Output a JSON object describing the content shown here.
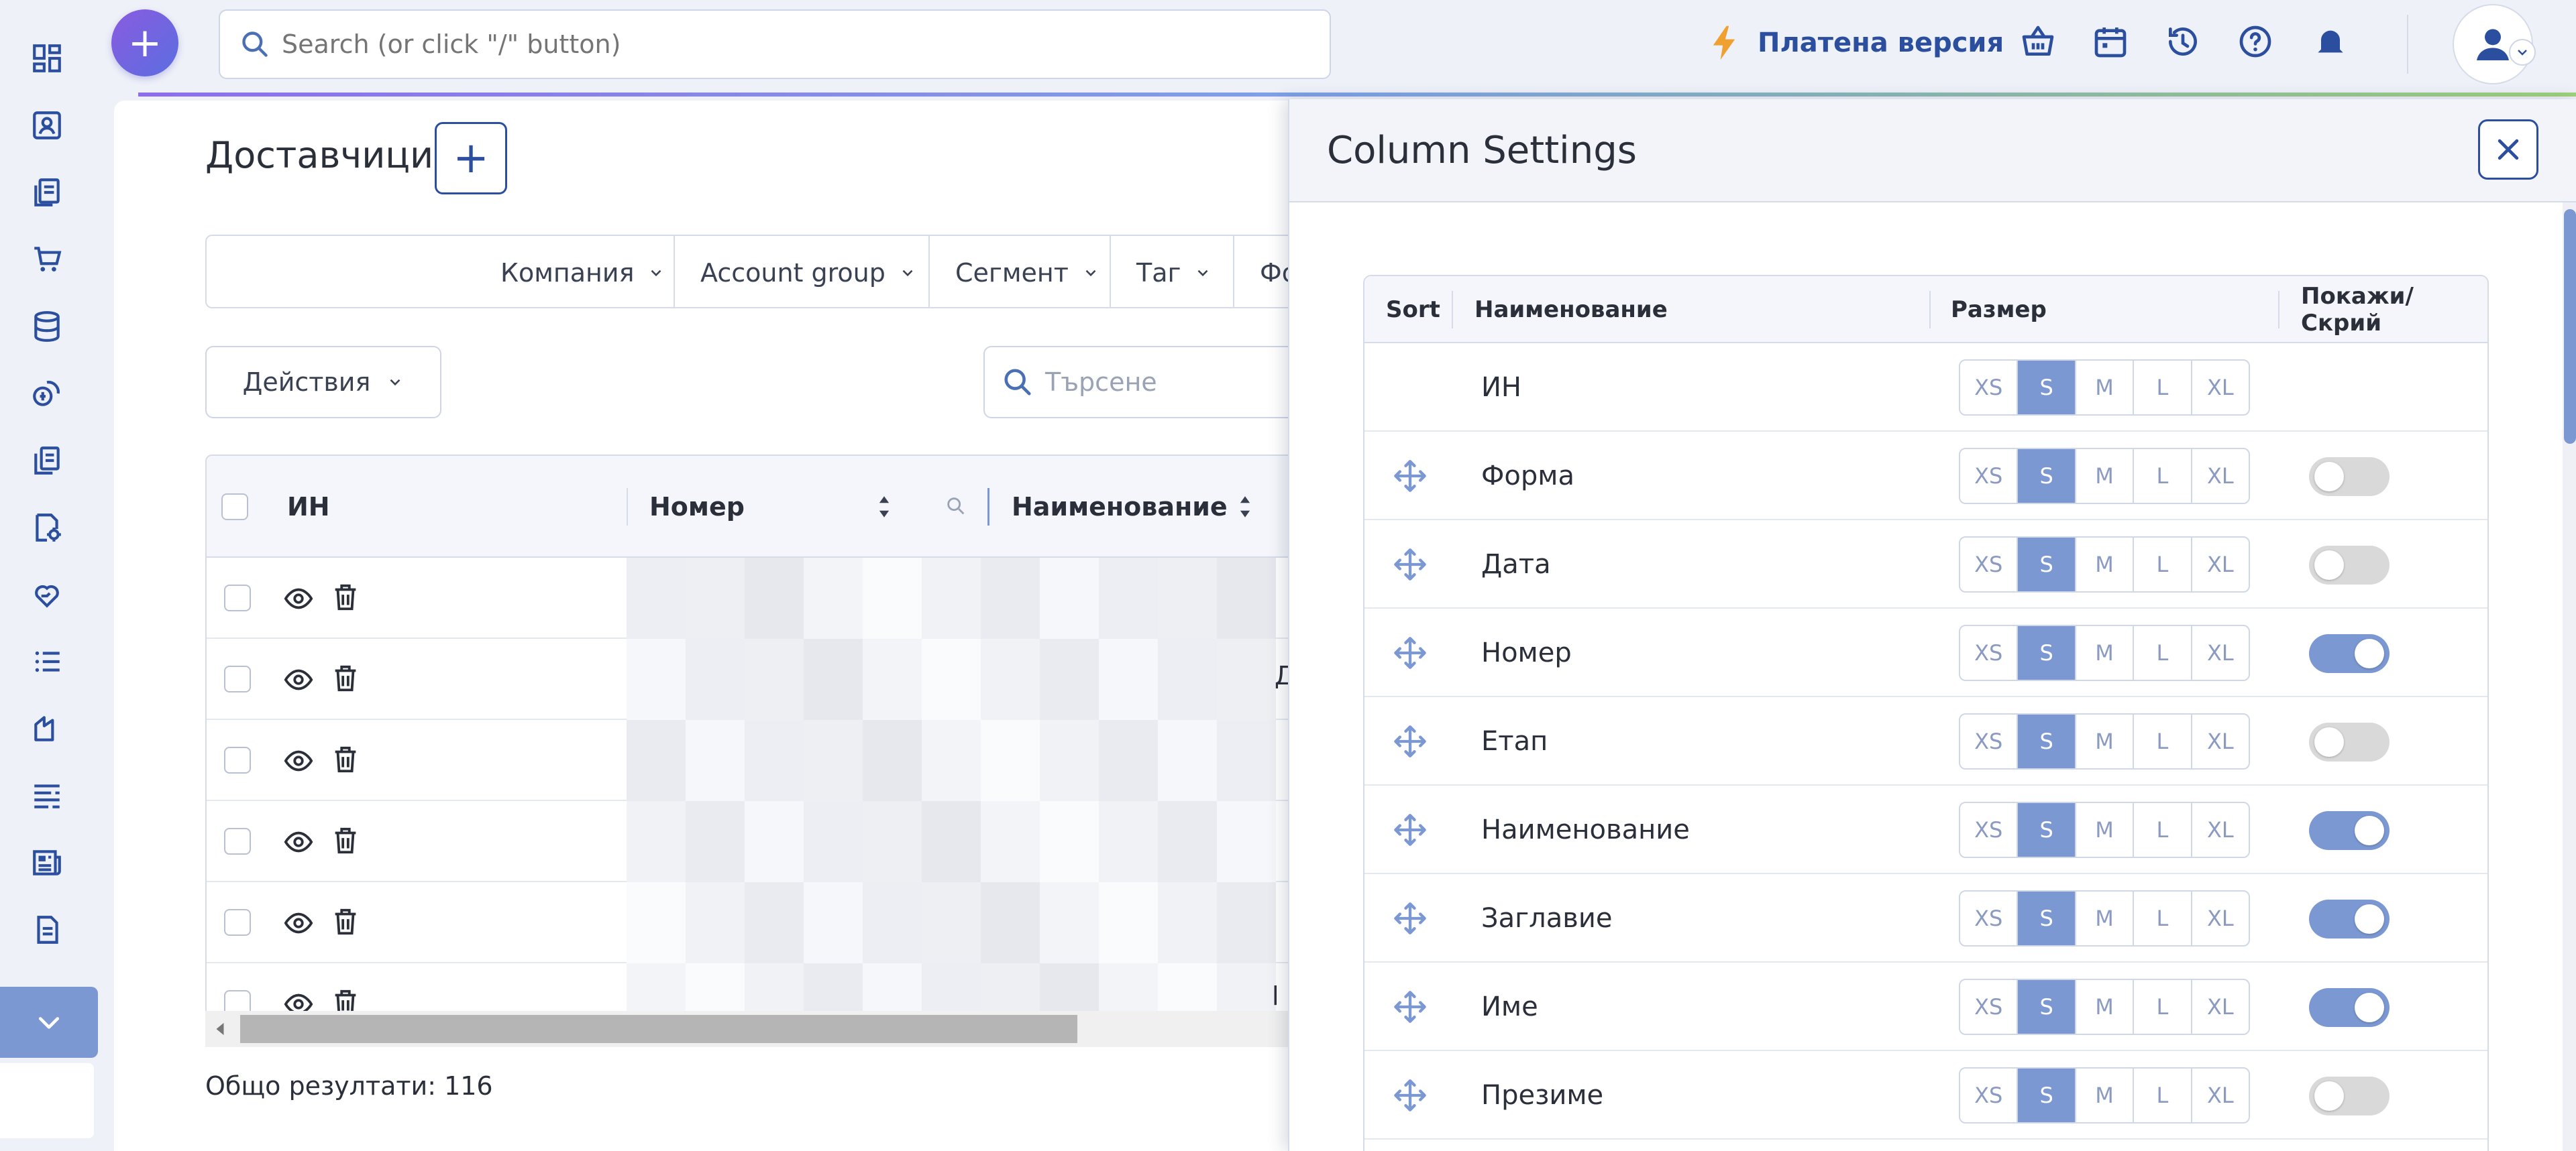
{
  "topbar": {
    "search_placeholder": "Search (or click \"/\" button)",
    "paid_label": "Платена версия"
  },
  "page": {
    "title": "Доставчици",
    "actions_label": "Действия",
    "search_placeholder": "Търсене",
    "total_label": "Общо резултати: 116"
  },
  "filters": [
    "Компания",
    "Account group",
    "Сегмент",
    "Таг",
    "Фо"
  ],
  "table": {
    "columns": [
      "ИН",
      "Номер",
      "Наименование"
    ],
    "clipped_cells": [
      "Д",
      "l"
    ]
  },
  "column_settings": {
    "title": "Column Settings",
    "headers": {
      "sort": "Sort",
      "name": "Наименование",
      "size": "Размер",
      "visibility": "Покажи/Скрий"
    },
    "size_options": [
      "XS",
      "S",
      "M",
      "L",
      "XL"
    ],
    "rows": [
      {
        "name": "ИН",
        "size": "S",
        "visible": null,
        "draggable": false
      },
      {
        "name": "Форма",
        "size": "S",
        "visible": false,
        "draggable": true
      },
      {
        "name": "Дата",
        "size": "S",
        "visible": false,
        "draggable": true
      },
      {
        "name": "Номер",
        "size": "S",
        "visible": true,
        "draggable": true
      },
      {
        "name": "Етап",
        "size": "S",
        "visible": false,
        "draggable": true
      },
      {
        "name": "Наименование",
        "size": "S",
        "visible": true,
        "draggable": true
      },
      {
        "name": "Заглавие",
        "size": "S",
        "visible": true,
        "draggable": true
      },
      {
        "name": "Име",
        "size": "S",
        "visible": true,
        "draggable": true
      },
      {
        "name": "Презиме",
        "size": "S",
        "visible": false,
        "draggable": true
      }
    ]
  },
  "colors": {
    "accent": "#7b98d2",
    "brand_dark": "#2b4f9e",
    "bolt": "#f0a030"
  },
  "icons": {
    "rail": [
      "dashboard-icon",
      "contact-card-icon",
      "documents-icon",
      "cart-icon",
      "database-icon",
      "coins-icon",
      "files-icon",
      "settings-doc-icon",
      "heart-hand-icon",
      "list-icon",
      "shapes-icon",
      "lines-icon",
      "newspaper-icon",
      "document-icon"
    ],
    "top": [
      "basket-icon",
      "calendar-icon",
      "history-icon",
      "help-icon",
      "bell-icon"
    ]
  }
}
